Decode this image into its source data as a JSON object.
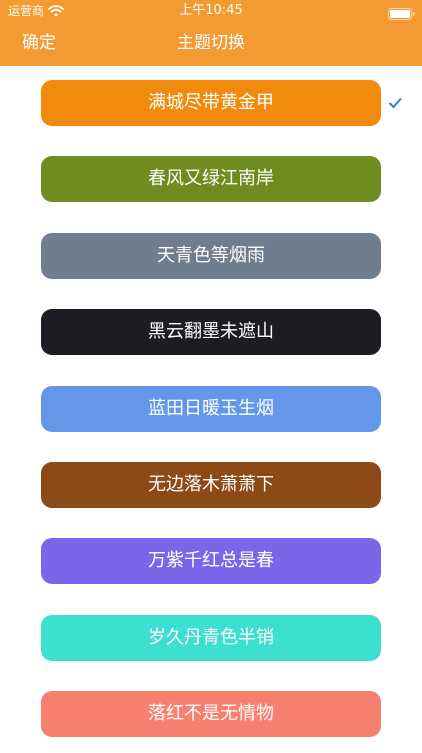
{
  "status_bar": {
    "carrier": "运营商",
    "time": "上午10:45",
    "wifi_icon": "wifi-icon",
    "battery_icon": "battery-icon"
  },
  "nav": {
    "confirm_label": "确定",
    "title": "主题切换"
  },
  "colors": {
    "header": "#f49a33",
    "check": "#2f7ee0"
  },
  "themes": [
    {
      "label": "满城尽带黄金甲",
      "color": "#f18a0d",
      "selected": true
    },
    {
      "label": "春风又绿江南岸",
      "color": "#6f8c1f",
      "selected": false
    },
    {
      "label": "天青色等烟雨",
      "color": "#6e7e8f",
      "selected": false
    },
    {
      "label": "黑云翻墨未遮山",
      "color": "#1b1d22",
      "selected": false
    },
    {
      "label": "蓝田日暖玉生烟",
      "color": "#6497e9",
      "selected": false
    },
    {
      "label": "无边落木萧萧下",
      "color": "#8d4a17",
      "selected": false
    },
    {
      "label": "万紫千红总是春",
      "color": "#7d65ea",
      "selected": false
    },
    {
      "label": "岁久丹青色半销",
      "color": "#3ddfd1",
      "selected": false
    },
    {
      "label": "落红不是无情物",
      "color": "#f88070",
      "selected": false
    }
  ]
}
